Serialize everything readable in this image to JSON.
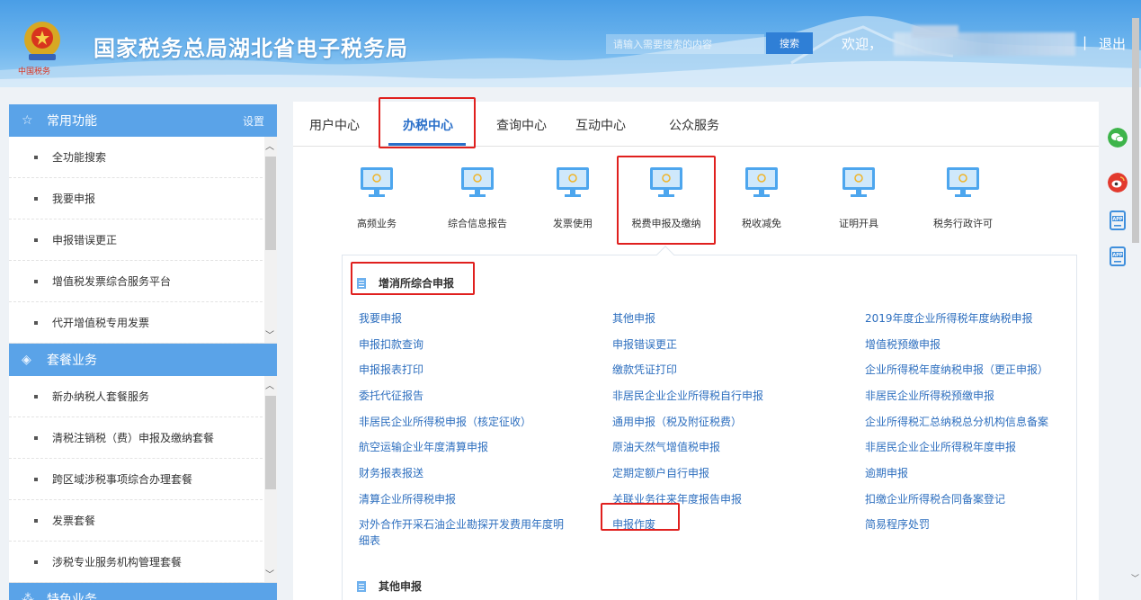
{
  "header": {
    "site_title": "国家税务总局湖北省电子税务局",
    "slogan": "中国税务",
    "search_placeholder": "请输入需要搜索的内容",
    "search_button": "搜索",
    "welcome": "欢迎，",
    "separator": "|",
    "logout": "退出"
  },
  "sidebar": {
    "common": {
      "title": "常用功能",
      "setting": "设置",
      "items": [
        "全功能搜索",
        "我要申报",
        "申报错误更正",
        "增值税发票综合服务平台",
        "代开增值税专用发票"
      ]
    },
    "package": {
      "title": "套餐业务",
      "items": [
        "新办纳税人套餐服务",
        "清税注销税（费）申报及缴纳套餐",
        "跨区域涉税事项综合办理套餐",
        "发票套餐",
        "涉税专业服务机构管理套餐"
      ]
    },
    "special": {
      "title": "特色业务"
    }
  },
  "tabs": [
    "用户中心",
    "办税中心",
    "查询中心",
    "互动中心",
    "公众服务"
  ],
  "categories": [
    "高频业务",
    "综合信息报告",
    "发票使用",
    "税费申报及缴纳",
    "税收减免",
    "证明开具",
    "税务行政许可"
  ],
  "panel": {
    "group1_title": "增消所综合申报",
    "col1": [
      "我要申报",
      "申报扣款查询",
      "申报报表打印",
      "委托代征报告",
      "非居民企业所得税申报（核定征收）",
      "航空运输企业年度清算申报",
      "财务报表报送",
      "清算企业所得税申报",
      "对外合作开采石油企业勘探开发费用年度明",
      "细表"
    ],
    "col2": [
      "其他申报",
      "申报错误更正",
      "缴款凭证打印",
      "非居民企业企业所得税自行申报",
      "通用申报（税及附征税费）",
      "原油天然气增值税申报",
      "定期定额户自行申报",
      "关联业务往来年度报告申报",
      "申报作废"
    ],
    "col3": [
      "2019年度企业所得税年度纳税申报",
      "增值税预缴申报",
      "企业所得税年度纳税申报（更正申报）",
      "非居民企业所得税预缴申报",
      "企业所得税汇总纳税总分机构信息备案",
      "非居民企业企业所得税年度申报",
      "逾期申报",
      "扣缴企业所得税合同备案登记",
      "简易程序处罚"
    ],
    "group2_title": "其他申报"
  },
  "icons": {
    "star": "star-icon",
    "layers": "layers-icon",
    "grid": "grid-icon",
    "wechat": "wechat-icon",
    "weibo": "weibo-icon",
    "app": "app-icon"
  },
  "colors": {
    "accent": "#2a6fc9",
    "sidebar_head": "#5aa3e8",
    "highlight": "#e0201e",
    "link": "#2e6fbf"
  }
}
